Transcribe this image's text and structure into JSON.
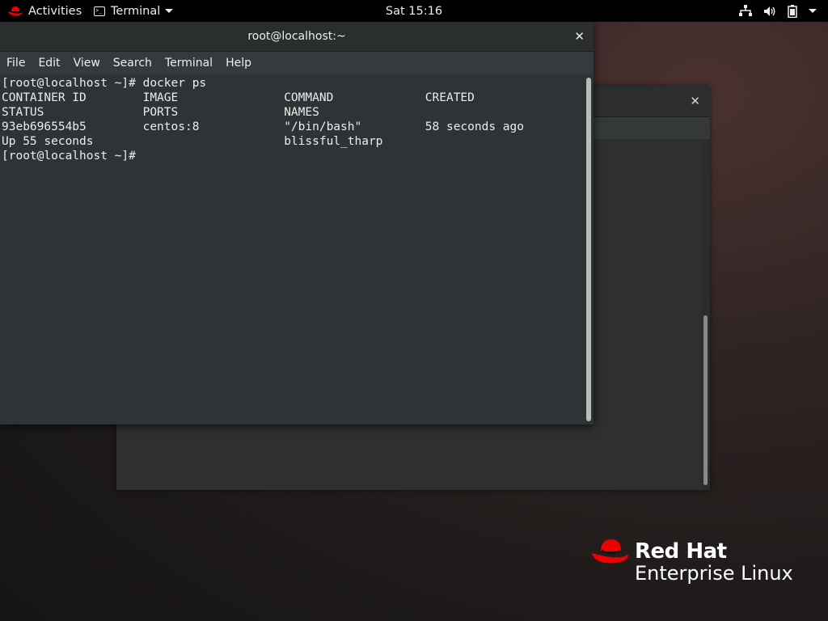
{
  "topbar": {
    "activities_label": "Activities",
    "app_menu_label": "Terminal",
    "clock": "Sat 15:16",
    "icons": [
      "network-icon",
      "volume-icon",
      "battery-icon",
      "system-menu-caret-icon"
    ]
  },
  "terminal_window": {
    "title": "root@localhost:~",
    "menu": [
      "File",
      "Edit",
      "View",
      "Search",
      "Terminal",
      "Help"
    ],
    "lines": [
      "[root@localhost ~]# docker ps",
      "CONTAINER ID        IMAGE               COMMAND             CREATED",
      "STATUS              PORTS               NAMES",
      "93eb696554b5        centos:8            \"/bin/bash\"         58 seconds ago",
      "Up 55 seconds                           blissful_tharp",
      "[root@localhost ~]# "
    ]
  },
  "branding": {
    "line1": "Red Hat",
    "line2": "Enterprise Linux"
  },
  "colors": {
    "redhat_red": "#ee0000",
    "terminal_bg": "#2e3436",
    "topbar_bg": "#000000"
  }
}
